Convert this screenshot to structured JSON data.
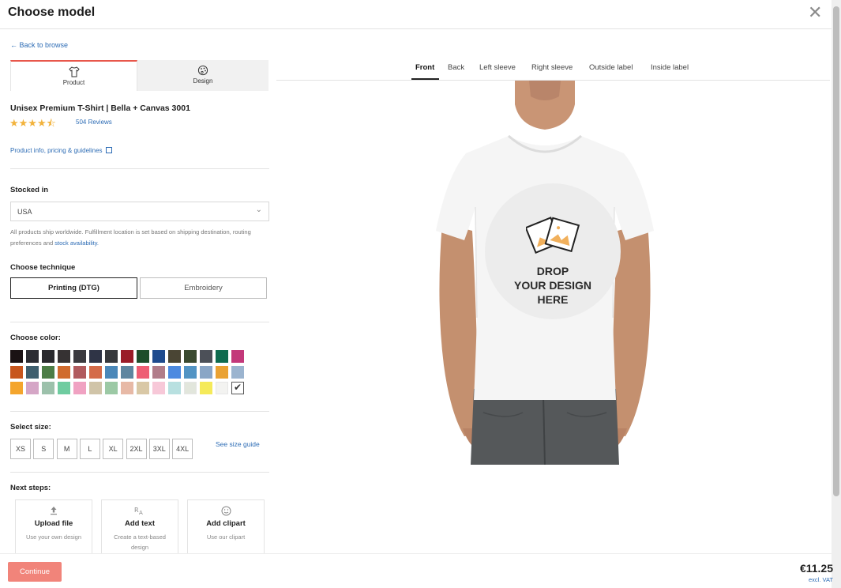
{
  "header": {
    "title": "Choose model"
  },
  "nav": {
    "back_label": "← Back to browse"
  },
  "panel_tabs": [
    {
      "label": "Product",
      "icon": "tshirt-icon",
      "active": true
    },
    {
      "label": "Design",
      "icon": "palette-icon",
      "active": false
    }
  ],
  "product": {
    "title": "Unisex Premium T-Shirt | Bella + Canvas 3001",
    "rating": 4.5,
    "stars_text": "★★★★⯪",
    "reviews_label": "504 Reviews",
    "info_link": "Product info, pricing & guidelines"
  },
  "stocked": {
    "label": "Stocked in",
    "value": "USA",
    "note_text": "All products ship worldwide. Fulfillment location is set based on shipping destination, routing preferences and ",
    "note_link": "stock availability."
  },
  "technique": {
    "label": "Choose technique",
    "options": [
      "Printing (DTG)",
      "Embroidery"
    ],
    "selected": "Printing (DTG)"
  },
  "colors": {
    "label": "Choose color:",
    "rows": [
      [
        "#1a1214",
        "#2c2d33",
        "#2a2a2e",
        "#363233",
        "#3b3a3f",
        "#2f3446",
        "#37393d",
        "#9a1c28",
        "#1e4d2b",
        "#1f4b8e",
        "#4a4534",
        "#3a4a30",
        "#4c5058",
        "#0f6b4f",
        "#c3387a"
      ],
      [
        "#c7561e",
        "#3f5f6e",
        "#4d7d46",
        "#d06b2e",
        "#b15b5e",
        "#d46b49",
        "#4b88b9",
        "#5e86a0",
        "#ee5e74",
        "#b17d8a",
        "#4d8ae0",
        "#5294c4",
        "#8aa6c6",
        "#eaa233",
        "#9bb4cf"
      ],
      [
        "#f4a52d",
        "#d5a6c6",
        "#9cc1ab",
        "#6fcca0",
        "#f0a2c2",
        "#d0c4a8",
        "#9cc9a5",
        "#e7b9a6",
        "#d9c8a6",
        "#f7c8d8",
        "#b8e0e0",
        "#e2e6dc",
        "#f5ea5a",
        "#f3f3f1",
        "#ffffff"
      ]
    ],
    "selected": "#ffffff"
  },
  "size": {
    "label": "Select size:",
    "options": [
      "XS",
      "S",
      "M",
      "L",
      "XL",
      "2XL",
      "3XL",
      "4XL"
    ],
    "guide_label": "See size guide"
  },
  "next_steps": {
    "label": "Next steps:",
    "items": [
      {
        "title": "Upload file",
        "desc": "Use your own design",
        "icon": "upload-icon"
      },
      {
        "title": "Add text",
        "desc": "Create a text-based design",
        "icon": "text-icon"
      },
      {
        "title": "Add clipart",
        "desc": "Use our clipart",
        "icon": "smiley-icon"
      }
    ]
  },
  "view_tabs": [
    {
      "label": "Front",
      "active": true
    },
    {
      "label": "Back",
      "active": false
    },
    {
      "label": "Left sleeve",
      "active": false
    },
    {
      "label": "Right sleeve",
      "active": false
    },
    {
      "label": "Outside label",
      "active": false
    },
    {
      "label": "Inside label",
      "active": false
    }
  ],
  "drop_zone": {
    "line1": "DROP",
    "line2": "YOUR DESIGN",
    "line3": "HERE"
  },
  "footer": {
    "continue_label": "Continue",
    "price": "€11.25",
    "vat_label": "excl. VAT"
  },
  "theme": {
    "accent": "#e8574b",
    "link": "#2d6cb5",
    "button": "#f1847a"
  }
}
